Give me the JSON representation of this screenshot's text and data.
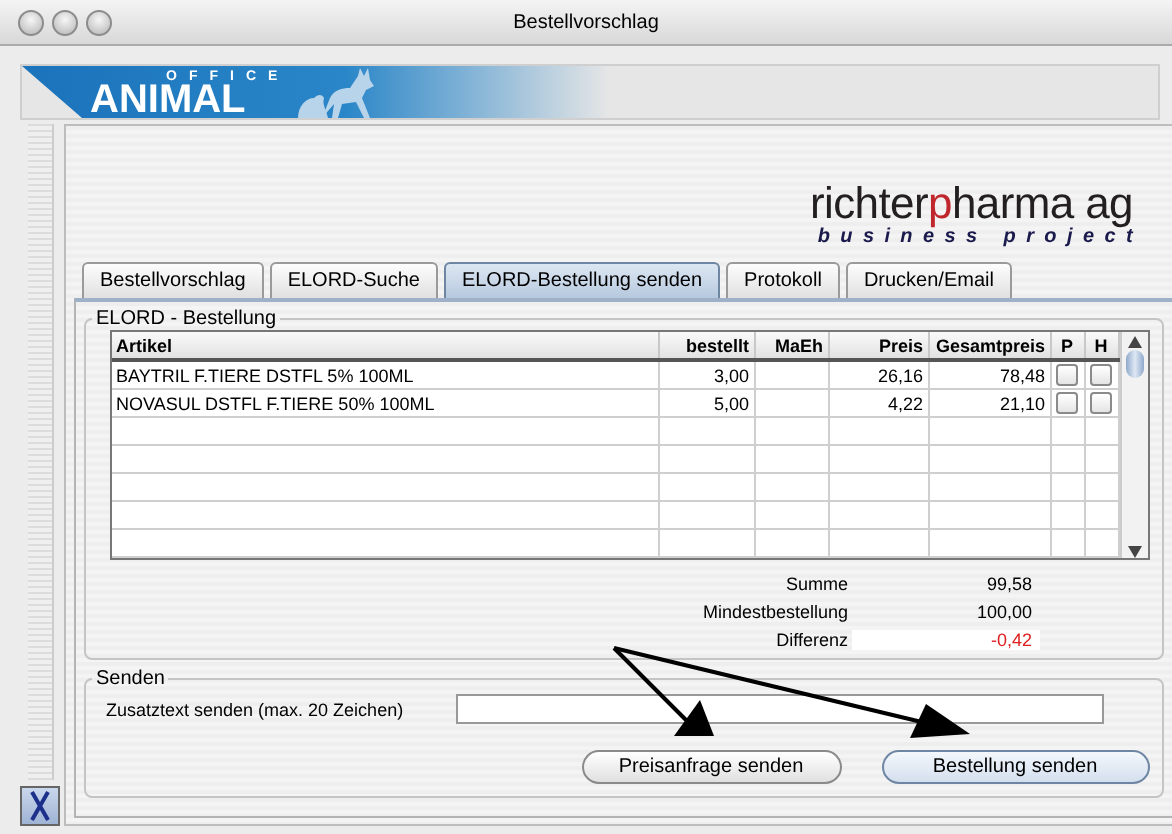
{
  "window": {
    "title": "Bestellvorschlag"
  },
  "banner": {
    "overline": "OFFICE",
    "name": "ANIMAL"
  },
  "logo": {
    "parts": [
      {
        "text": "richter",
        "color": "#231f20"
      },
      {
        "text": "p",
        "color": "#c0272d"
      },
      {
        "text": "harma ag",
        "color": "#231f20"
      }
    ],
    "tagline": "business project"
  },
  "tabs": [
    {
      "label": "Bestellvorschlag",
      "selected": false
    },
    {
      "label": "ELORD-Suche",
      "selected": false
    },
    {
      "label": "ELORD-Bestellung senden",
      "selected": true
    },
    {
      "label": "Protokoll",
      "selected": false
    },
    {
      "label": "Drucken/Email",
      "selected": false
    }
  ],
  "order_group": {
    "title": "ELORD - Bestellung"
  },
  "table": {
    "columns": [
      "Artikel",
      "bestellt",
      "MaEh",
      "Preis",
      "Gesamtpreis",
      "P",
      "H"
    ],
    "rows": [
      {
        "artikel": "BAYTRIL F.TIERE DSTFL  5%  100ML",
        "bestellt": "3,00",
        "maeh": "",
        "preis": "26,16",
        "gesamtpreis": "78,48",
        "p": false,
        "h": false
      },
      {
        "artikel": "NOVASUL DSTFL F.TIERE 50%  100ML",
        "bestellt": "5,00",
        "maeh": "",
        "preis": "4,22",
        "gesamtpreis": "21,10",
        "p": false,
        "h": false
      }
    ]
  },
  "summary": [
    {
      "label": "Summe",
      "value": "99,58",
      "negative": false
    },
    {
      "label": "Mindestbestellung",
      "value": "100,00",
      "negative": false
    },
    {
      "label": "Differenz",
      "value": "-0,42",
      "negative": true
    }
  ],
  "send_group": {
    "title": "Senden",
    "field_label": "Zusatztext senden (max. 20 Zeichen)",
    "buttons": [
      {
        "label": "Preisanfrage senden",
        "default": false
      },
      {
        "label": "Bestellung senden",
        "default": true
      }
    ]
  }
}
